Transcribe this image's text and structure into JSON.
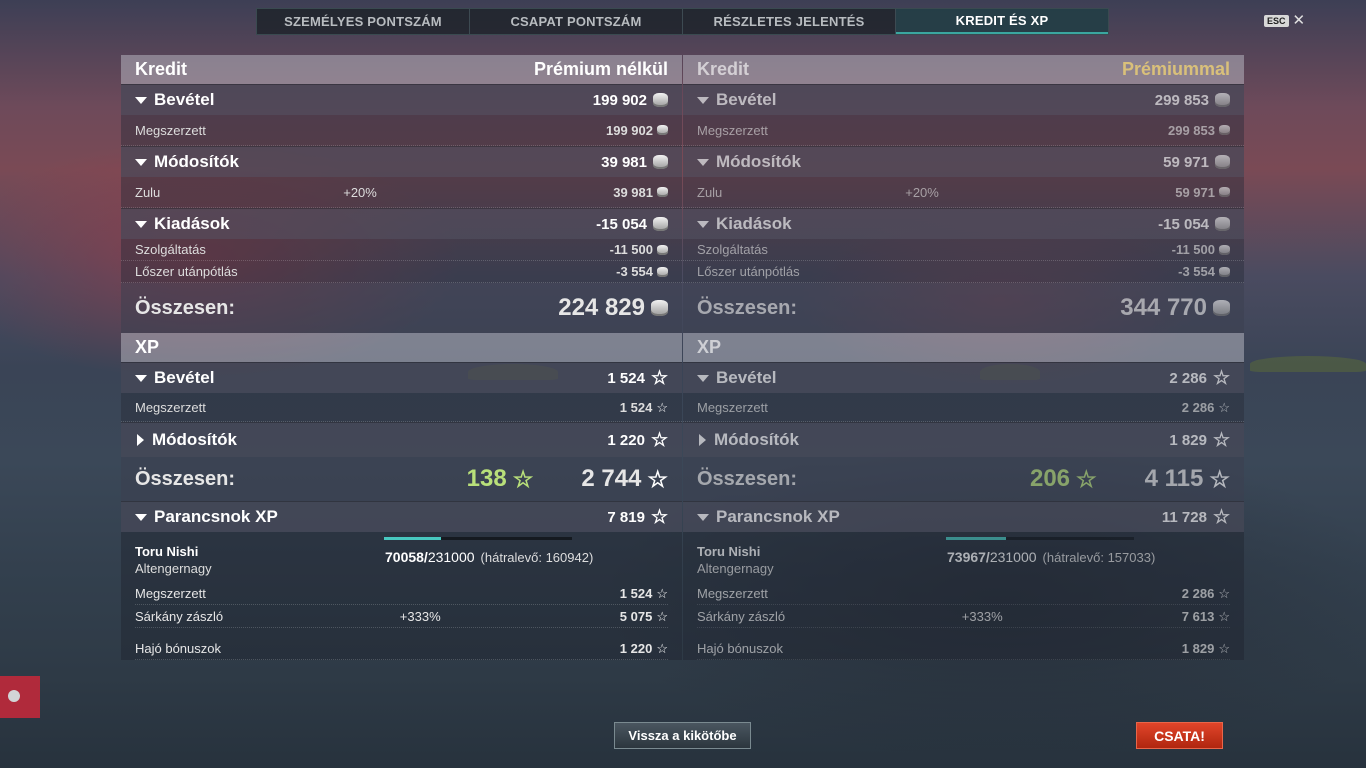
{
  "tabs": [
    "SZEMÉLYES PONTSZÁM",
    "CSAPAT PONTSZÁM",
    "RÉSZLETES JELENTÉS",
    "KREDIT ÉS XP"
  ],
  "esc_label": "ESC",
  "close_glyph": "✕",
  "star_glyph": "☆",
  "left": {
    "credit_title": "Kredit",
    "premium_label": "Prémium nélkül",
    "income_label": "Bevétel",
    "income_value": "199 902",
    "earned_label": "Megszerzett",
    "earned_value": "199 902",
    "modifiers_label": "Módosítók",
    "modifiers_value": "39 981",
    "zulu_label": "Zulu",
    "zulu_pct": "+20%",
    "zulu_value": "39 981",
    "expenses_label": "Kiadások",
    "expenses_value": "-15 054",
    "service_label": "Szolgáltatás",
    "service_value": "-11 500",
    "ammo_label": "Lőszer utánpótlás",
    "ammo_value": "-3 554",
    "credit_total_label": "Összesen:",
    "credit_total_value": "224 829",
    "xp_title": "XP",
    "xp_income_label": "Bevétel",
    "xp_income_value": "1 524",
    "xp_earned_label": "Megszerzett",
    "xp_earned_value": "1 524",
    "xp_modifiers_label": "Módosítók",
    "xp_modifiers_value": "1 220",
    "xp_total_label": "Összesen:",
    "xp_free_value": "138",
    "xp_total_value": "2 744",
    "cmdr_label": "Parancsnok XP",
    "cmdr_value": "7 819",
    "cmdr_name": "Toru Nishi",
    "cmdr_rank": "Altengernagy",
    "cmdr_progress": "70058/",
    "cmdr_max": "231000",
    "cmdr_remaining": "(hátralevő: 160942)",
    "cmdr_fraction": 0.303,
    "cmdr_earned_label": "Megszerzett",
    "cmdr_earned_value": "1 524",
    "flag_label": "Sárkány zászló",
    "flag_pct": "+333%",
    "flag_value": "5 075",
    "ship_bonus_label": "Hajó bónuszok",
    "ship_bonus_value": "1 220"
  },
  "right": {
    "credit_title": "Kredit",
    "premium_label": "Prémiummal",
    "income_label": "Bevétel",
    "income_value": "299 853",
    "earned_label": "Megszerzett",
    "earned_value": "299 853",
    "modifiers_label": "Módosítók",
    "modifiers_value": "59 971",
    "zulu_label": "Zulu",
    "zulu_pct": "+20%",
    "zulu_value": "59 971",
    "expenses_label": "Kiadások",
    "expenses_value": "-15 054",
    "service_label": "Szolgáltatás",
    "service_value": "-11 500",
    "ammo_label": "Lőszer utánpótlás",
    "ammo_value": "-3 554",
    "credit_total_label": "Összesen:",
    "credit_total_value": "344 770",
    "xp_title": "XP",
    "xp_income_label": "Bevétel",
    "xp_income_value": "2 286",
    "xp_earned_label": "Megszerzett",
    "xp_earned_value": "2 286",
    "xp_modifiers_label": "Módosítók",
    "xp_modifiers_value": "1 829",
    "xp_total_label": "Összesen:",
    "xp_free_value": "206",
    "xp_total_value": "4 115",
    "cmdr_label": "Parancsnok XP",
    "cmdr_value": "11 728",
    "cmdr_name": "Toru Nishi",
    "cmdr_rank": "Altengernagy",
    "cmdr_progress": "73967/",
    "cmdr_max": "231000",
    "cmdr_remaining": "(hátralevő: 157033)",
    "cmdr_fraction": 0.32,
    "cmdr_earned_label": "Megszerzett",
    "cmdr_earned_value": "2 286",
    "flag_label": "Sárkány zászló",
    "flag_pct": "+333%",
    "flag_value": "7 613",
    "ship_bonus_label": "Hajó bónuszok",
    "ship_bonus_value": "1 829"
  },
  "buttons": {
    "back": "Vissza a kikötőbe",
    "battle": "CSATA!"
  },
  "colors": {
    "accent": "#3aa7a0",
    "battle": "#c9341a",
    "free_xp": "#b9e07a",
    "premium": "#d9c07a"
  }
}
